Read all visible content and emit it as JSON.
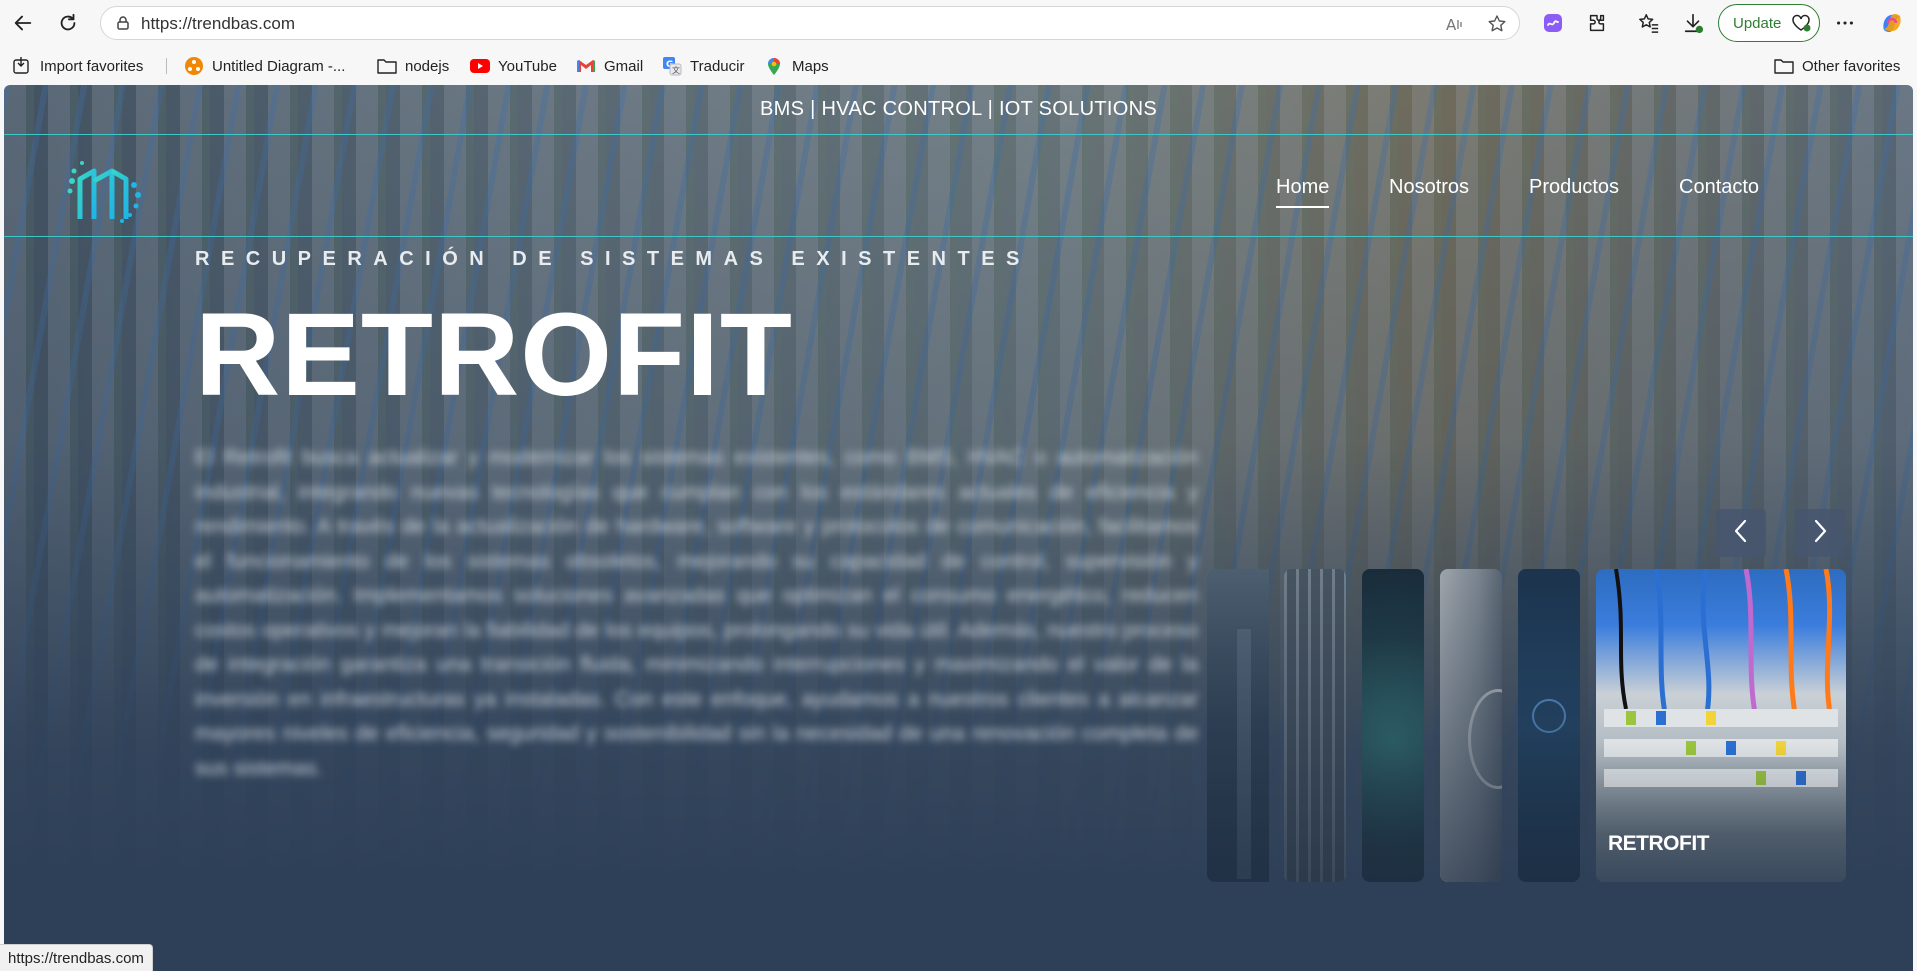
{
  "browser": {
    "url": "https://trendbas.com",
    "update_label": "Update",
    "status_url": "https://trendbas.com",
    "bookmarks": [
      {
        "label": "Import favorites",
        "icon": "import-icon"
      },
      {
        "label": "Untitled Diagram -...",
        "icon": "drawio-icon"
      },
      {
        "label": "nodejs",
        "icon": "folder-icon"
      },
      {
        "label": "YouTube",
        "icon": "youtube-icon"
      },
      {
        "label": "Gmail",
        "icon": "gmail-icon"
      },
      {
        "label": "Traducir",
        "icon": "translate-icon"
      },
      {
        "label": "Maps",
        "icon": "maps-icon"
      }
    ],
    "other_favorites": "Other favorites"
  },
  "site": {
    "tagline": "BMS | HVAC CONTROL | IOT SOLUTIONS",
    "nav": [
      {
        "label": "Home",
        "active": true
      },
      {
        "label": "Nosotros",
        "active": false
      },
      {
        "label": "Productos",
        "active": false
      },
      {
        "label": "Contacto",
        "active": false
      }
    ],
    "hero": {
      "kicker": "RECUPERACIÓN DE SISTEMAS EXISTENTES",
      "title": "RETROFIT",
      "body": "El Retrofit busca actualizar y modernizar los sistemas existentes, como BMS, HVAC o automatización industrial, integrando nuevas tecnologías que cumplan con los estándares actuales de eficiencia y rendimiento. A través de la actualización de hardware, software y protocolos de comunicación, facilitamos el funcionamiento de los sistemas obsoletos, mejorando su capacidad de control, supervisión y automatización. Implementamos soluciones avanzadas que optimizan el consumo energético, reducen costos operativos y mejoran la fiabilidad de los equipos, prolongando su vida útil. Además, nuestro proceso de integración garantiza una transición fluida, minimizando interrupciones y maximizando el valor de la inversión en infraestructuras ya instaladas. Con este enfoque, ayudamos a nuestros clientes a alcanzar mayores niveles de eficiencia, seguridad y sostenibilidad sin la necesidad de una renovación completa de sus sistemas."
    },
    "slider": {
      "active_label": "RETROFIT"
    }
  },
  "colors": {
    "accent": "#3fc6c6",
    "page_bg": "#2e4058",
    "update_green": "#2e7d32"
  }
}
